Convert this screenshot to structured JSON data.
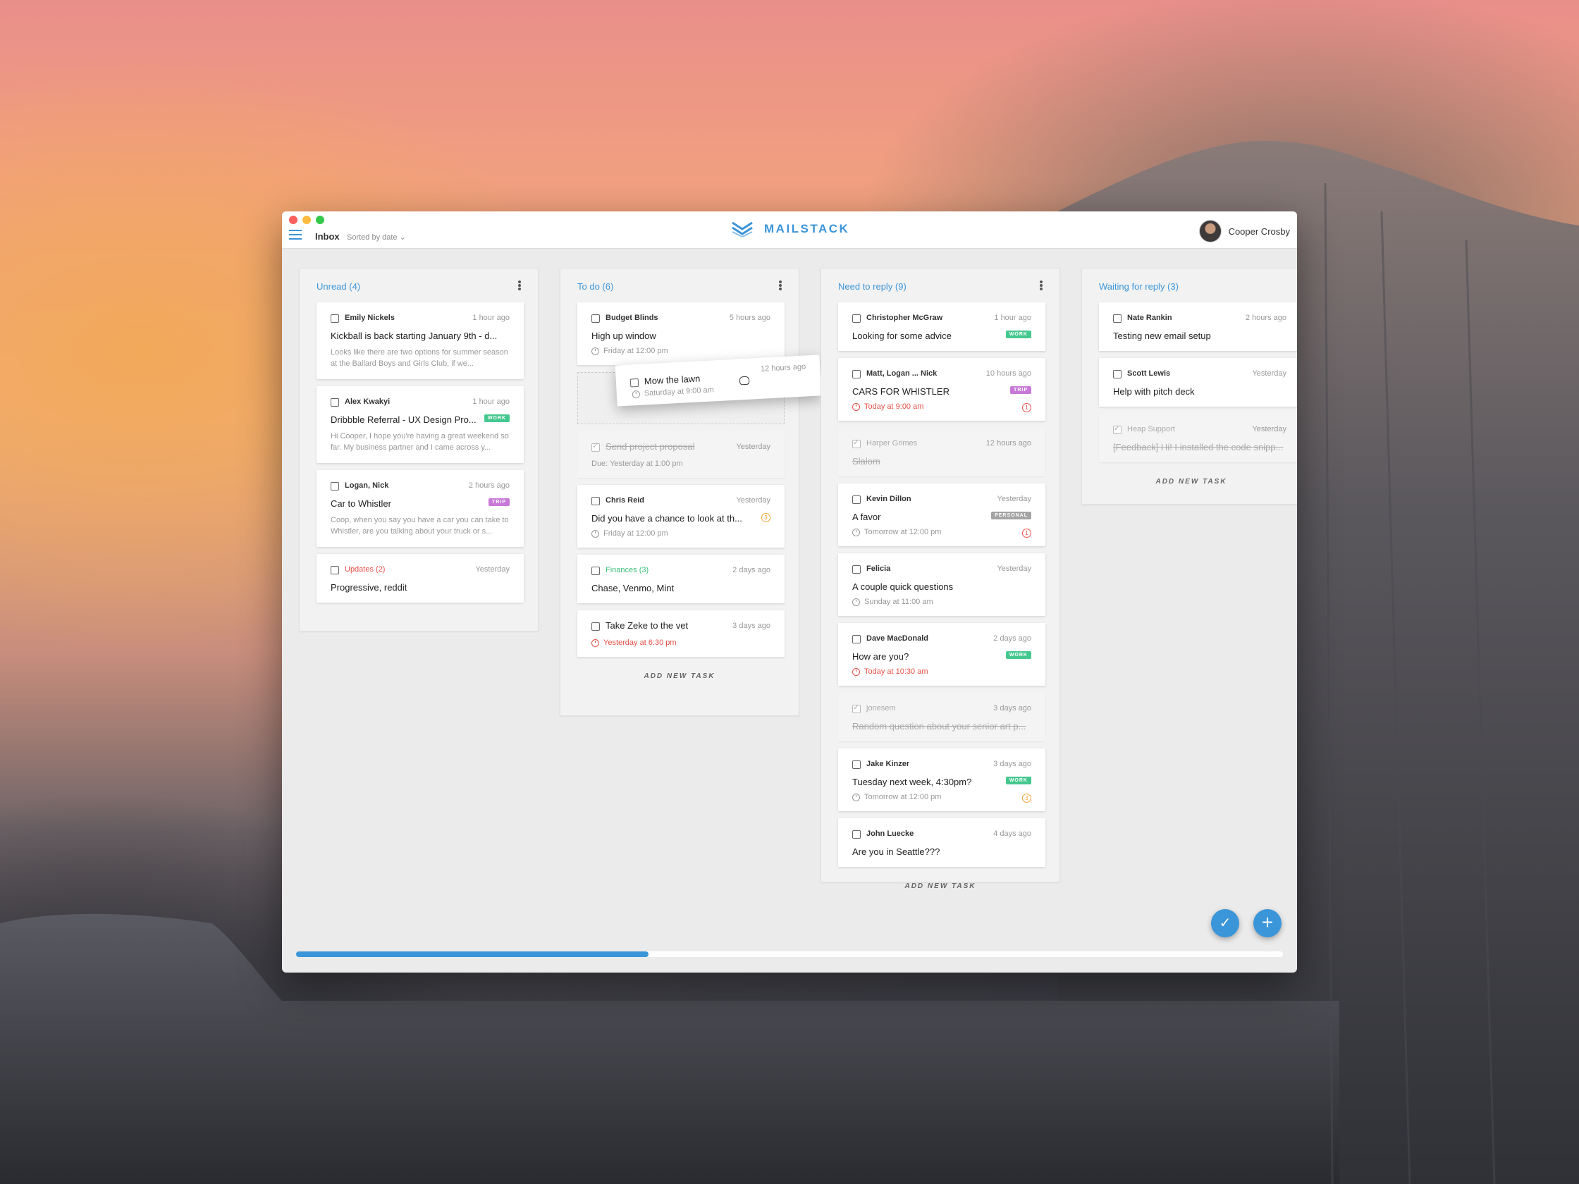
{
  "header": {
    "title": "Inbox",
    "sort_label": "Sorted by date ⌄",
    "brand": "MAILSTACK",
    "user_name": "Cooper Crosby"
  },
  "colors": {
    "accent": "#3b95d9",
    "work_tag": "#45c88f",
    "trip_tag": "#c879d8",
    "personal_tag": "#a4a4a4",
    "alert_red": "#e55047"
  },
  "columns": {
    "unread": {
      "title": "Unread (4)",
      "cards": [
        {
          "sender": "Emily Nickels",
          "time": "1 hour ago",
          "subject": "Kickball is back starting January 9th - d...",
          "preview": "Looks like there are two options for summer season at the Ballard Boys and Girls Club, if we..."
        },
        {
          "sender": "Alex Kwakyi",
          "time": "1 hour ago",
          "subject": "Dribbble Referral - UX Design Pro...",
          "tag": "WORK",
          "preview": "Hi Cooper, I hope you're having a great weekend so far. My business partner and I came across y..."
        },
        {
          "sender": "Logan, Nick",
          "time": "2 hours ago",
          "subject": "Car to Whistler",
          "tag": "TRIP",
          "preview": "Coop, when you say you have a car you can take to Whistler, are you talking about your truck or s..."
        },
        {
          "sender": "Updates (2)",
          "time": "Yesterday",
          "subject": "Progressive, reddit"
        }
      ]
    },
    "todo": {
      "title": "To do (6)",
      "cards": [
        {
          "sender": "Budget Blinds",
          "time": "5 hours ago",
          "subject": "High up window",
          "meta": "Friday at 12:00 pm"
        },
        {
          "sender": "",
          "time": "Yesterday",
          "subject": "Send project proposal",
          "meta": "Due: Yesterday at 1:00 pm"
        },
        {
          "sender": "Chris Reid",
          "time": "Yesterday",
          "subject": "Did you have a chance to look at th...",
          "badge": "3",
          "meta": "Friday at 12:00 pm"
        },
        {
          "sender": "Finances (3)",
          "time": "2 days ago",
          "subject": "Chase, Venmo, Mint"
        },
        {
          "sender": "",
          "time": "3 days ago",
          "subject": "Take Zeke to the vet",
          "meta": "Yesterday at 6:30 pm"
        }
      ],
      "dragging": {
        "subject": "Mow the lawn",
        "time": "12 hours ago",
        "meta": "Saturday at 9:00 am"
      },
      "add_label": "ADD NEW TASK"
    },
    "reply": {
      "title": "Need to reply (9)",
      "cards": [
        {
          "sender": "Christopher McGraw",
          "time": "1 hour ago",
          "subject": "Looking for some advice",
          "tag": "WORK"
        },
        {
          "sender": "Matt, Logan ... Nick",
          "time": "10 hours ago",
          "subject": "CARS FOR WHISTLER",
          "tag": "TRIP",
          "meta": "Today at 9:00 am",
          "badge": "1"
        },
        {
          "sender": "Harper Grimes",
          "time": "12 hours ago",
          "subject": "Slalom"
        },
        {
          "sender": "Kevin Dillon",
          "time": "Yesterday",
          "subject": "A favor",
          "tag": "PERSONAL",
          "meta": "Tomorrow at 12:00 pm",
          "badge": "1"
        },
        {
          "sender": "Felicia",
          "time": "Yesterday",
          "subject": "A couple quick questions",
          "meta": "Sunday at 11:00 am"
        },
        {
          "sender": "Dave MacDonald",
          "time": "2 days ago",
          "subject": "How are you?",
          "tag": "WORK",
          "meta": "Today at 10:30 am"
        },
        {
          "sender": "jonesem",
          "time": "3 days ago",
          "subject": "Random question about your senior art p..."
        },
        {
          "sender": "Jake Kinzer",
          "time": "3 days ago",
          "subject": "Tuesday next week, 4:30pm?",
          "tag": "WORK",
          "meta": "Tomorrow at 12:00 pm",
          "badge": "3"
        },
        {
          "sender": "John Luecke",
          "time": "4 days ago",
          "subject": "Are you in Seattle???"
        }
      ],
      "add_label": "ADD NEW TASK"
    },
    "waiting": {
      "title": "Waiting for reply (3)",
      "cards": [
        {
          "sender": "Nate Rankin",
          "time": "2 hours ago",
          "subject": "Testing new email setup"
        },
        {
          "sender": "Scott Lewis",
          "time": "Yesterday",
          "subject": "Help with pitch deck"
        },
        {
          "sender": "Heap Support",
          "time": "Yesterday",
          "subject": "[Feedback] Hi! I installed the code snipp..."
        }
      ],
      "add_label": "ADD NEW TASK"
    }
  },
  "progress": 0.357,
  "fabs": {
    "check_icon": "check-all-icon",
    "plus_icon": "plus-icon"
  }
}
